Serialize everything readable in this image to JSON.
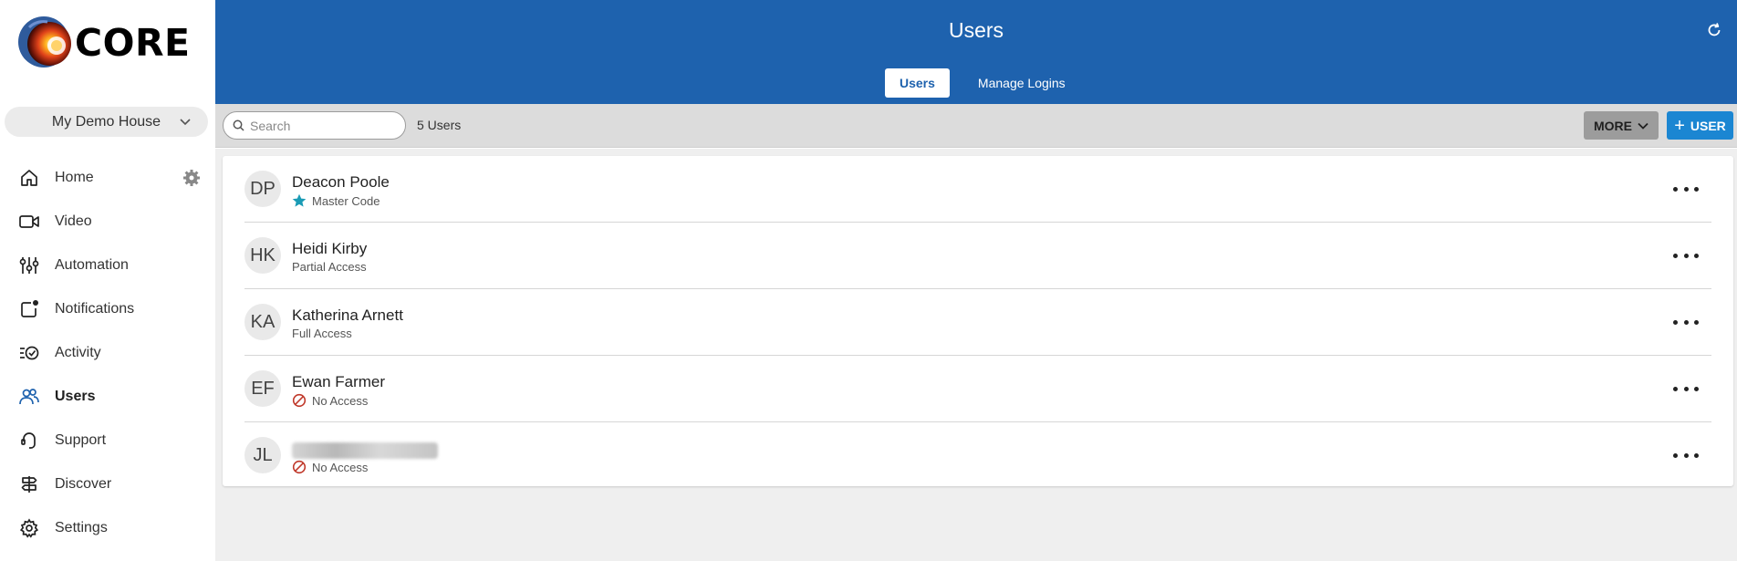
{
  "app": {
    "logo_text": "CORE"
  },
  "sidebar": {
    "house": "My Demo House",
    "items": [
      {
        "label": "Home",
        "icon": "home-icon"
      },
      {
        "label": "Video",
        "icon": "video-icon"
      },
      {
        "label": "Automation",
        "icon": "sliders-icon"
      },
      {
        "label": "Notifications",
        "icon": "notifications-icon"
      },
      {
        "label": "Activity",
        "icon": "activity-icon"
      },
      {
        "label": "Users",
        "icon": "users-icon",
        "active": true
      },
      {
        "label": "Support",
        "icon": "headset-icon"
      },
      {
        "label": "Discover",
        "icon": "signpost-icon"
      },
      {
        "label": "Settings",
        "icon": "gear-icon"
      }
    ]
  },
  "header": {
    "title": "Users",
    "tabs": [
      {
        "label": "Users",
        "active": true
      },
      {
        "label": "Manage Logins",
        "active": false
      }
    ]
  },
  "toolbar": {
    "search_placeholder": "Search",
    "count": "5 Users",
    "more_label": "MORE",
    "user_label": "USER"
  },
  "users": [
    {
      "initials": "DP",
      "name": "Deacon Poole",
      "access": "Master Code",
      "access_icon": "star-icon"
    },
    {
      "initials": "HK",
      "name": "Heidi Kirby",
      "access": "Partial Access",
      "access_icon": ""
    },
    {
      "initials": "KA",
      "name": "Katherina Arnett",
      "access": "Full Access",
      "access_icon": ""
    },
    {
      "initials": "EF",
      "name": "Ewan Farmer",
      "access": "No Access",
      "access_icon": "no-access-icon"
    },
    {
      "initials": "JL",
      "name": "",
      "access": "No Access",
      "access_icon": "no-access-icon"
    }
  ],
  "colors": {
    "header_blue": "#1e62ae",
    "button_blue": "#1b86d2",
    "star_teal": "#1a9bb5",
    "no_access_red": "#c0392b"
  }
}
